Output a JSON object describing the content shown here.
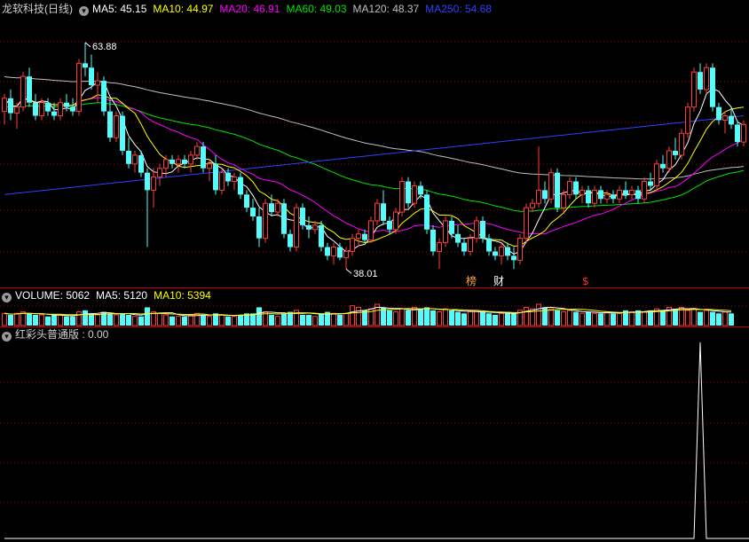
{
  "header": {
    "title": "龙软科技(日线)",
    "ma5": "MA5: 45.15",
    "ma10": "MA10: 44.97",
    "ma20": "MA20: 46.91",
    "ma60": "MA60: 49.03",
    "ma120": "MA120: 48.37",
    "ma250": "MA250: 54.68"
  },
  "volume_header": {
    "label": "VOLUME: 5062",
    "ma5": "MA5: 5120",
    "ma10": "MA10: 5394"
  },
  "indicator_header": {
    "label": "红彩头普通版 : 0.00"
  },
  "annotations": {
    "high": "63.88",
    "low": "38.01",
    "badge_bang": "榜",
    "badge_cai": "财",
    "badge_dollar": "$"
  },
  "colors": {
    "up": "#ff3c3c",
    "down": "#54fcfc",
    "ma5": "#ffffff",
    "ma10": "#ffff00",
    "ma20": "#ff00ff",
    "ma60": "#00e600",
    "ma120": "#c0c0c0",
    "ma250": "#3040ff",
    "grid": "#a00000"
  },
  "chart_data": {
    "type": "candlestick",
    "price_range": [
      36.5,
      66.5
    ],
    "candles": [
      [
        56.0,
        58.0,
        54.5,
        57.5
      ],
      [
        57.5,
        58.5,
        55.0,
        55.8
      ],
      [
        55.8,
        57.0,
        54.0,
        56.5
      ],
      [
        56.5,
        60.5,
        56.0,
        60.0
      ],
      [
        60.0,
        61.0,
        56.5,
        57.0
      ],
      [
        57.0,
        58.0,
        55.0,
        55.5
      ],
      [
        55.5,
        57.5,
        55.0,
        57.0
      ],
      [
        57.0,
        57.5,
        55.5,
        56.0
      ],
      [
        56.0,
        57.0,
        55.0,
        55.5
      ],
      [
        55.5,
        57.5,
        55.0,
        57.0
      ],
      [
        57.0,
        58.0,
        56.0,
        56.5
      ],
      [
        56.5,
        57.5,
        55.5,
        56.0
      ],
      [
        56.0,
        62.0,
        55.5,
        61.5
      ],
      [
        61.5,
        63.88,
        60.0,
        61.0
      ],
      [
        61.0,
        62.5,
        58.5,
        59.0
      ],
      [
        59.0,
        60.5,
        57.0,
        59.5
      ],
      [
        59.5,
        60.0,
        55.5,
        56.0
      ],
      [
        56.0,
        57.5,
        52.5,
        53.0
      ],
      [
        53.0,
        56.0,
        52.5,
        55.5
      ],
      [
        55.5,
        56.0,
        51.0,
        51.5
      ],
      [
        51.5,
        53.0,
        49.5,
        50.0
      ],
      [
        50.0,
        51.5,
        49.0,
        51.0
      ],
      [
        51.0,
        51.5,
        48.5,
        49.0
      ],
      [
        49.0,
        49.5,
        40.5,
        47.0
      ],
      [
        47.0,
        49.5,
        45.0,
        48.5
      ],
      [
        48.5,
        50.0,
        47.5,
        49.5
      ],
      [
        49.5,
        51.0,
        48.5,
        50.5
      ],
      [
        50.5,
        51.0,
        49.5,
        50.0
      ],
      [
        50.0,
        51.0,
        49.0,
        50.5
      ],
      [
        50.5,
        51.0,
        49.5,
        50.0
      ],
      [
        50.0,
        51.5,
        49.0,
        51.0
      ],
      [
        51.0,
        52.5,
        50.5,
        52.0
      ],
      [
        52.0,
        52.5,
        49.0,
        49.5
      ],
      [
        49.5,
        50.5,
        48.0,
        50.0
      ],
      [
        50.0,
        51.0,
        46.5,
        47.0
      ],
      [
        47.0,
        49.5,
        46.5,
        49.0
      ],
      [
        49.0,
        49.5,
        47.5,
        48.0
      ],
      [
        48.0,
        49.0,
        47.0,
        48.5
      ],
      [
        48.5,
        49.0,
        46.0,
        46.5
      ],
      [
        46.5,
        47.0,
        44.5,
        45.0
      ],
      [
        45.0,
        46.0,
        43.5,
        44.0
      ],
      [
        44.0,
        45.0,
        40.5,
        41.5
      ],
      [
        41.5,
        46.0,
        41.0,
        45.5
      ],
      [
        45.5,
        46.5,
        44.0,
        44.5
      ],
      [
        44.5,
        46.0,
        44.0,
        45.5
      ],
      [
        45.5,
        46.0,
        41.5,
        42.0
      ],
      [
        42.0,
        42.5,
        40.0,
        40.5
      ],
      [
        40.5,
        45.5,
        40.0,
        45.0
      ],
      [
        45.0,
        45.5,
        42.5,
        43.0
      ],
      [
        43.0,
        44.0,
        41.5,
        42.5
      ],
      [
        42.5,
        43.5,
        42.0,
        43.0
      ],
      [
        43.0,
        43.5,
        40.0,
        40.5
      ],
      [
        40.5,
        41.0,
        39.0,
        39.5
      ],
      [
        39.5,
        41.0,
        38.5,
        40.5
      ],
      [
        40.5,
        41.0,
        39.0,
        39.3
      ],
      [
        39.3,
        40.5,
        38.0,
        40.0
      ],
      [
        40.0,
        42.0,
        39.5,
        41.5
      ],
      [
        41.5,
        42.5,
        40.5,
        42.0
      ],
      [
        42.0,
        42.5,
        41.0,
        41.3
      ],
      [
        41.3,
        44.0,
        41.0,
        43.5
      ],
      [
        43.5,
        46.0,
        43.0,
        45.5
      ],
      [
        45.5,
        47.0,
        43.0,
        43.5
      ],
      [
        43.5,
        44.0,
        42.0,
        42.5
      ],
      [
        42.5,
        45.0,
        42.0,
        44.5
      ],
      [
        44.5,
        48.5,
        44.0,
        48.0
      ],
      [
        48.0,
        48.5,
        45.0,
        45.5
      ],
      [
        45.5,
        48.0,
        45.0,
        47.5
      ],
      [
        47.5,
        48.0,
        46.0,
        46.5
      ],
      [
        46.5,
        47.0,
        42.0,
        42.5
      ],
      [
        42.5,
        43.0,
        39.5,
        40.0
      ],
      [
        40.0,
        41.5,
        38.01,
        41.0
      ],
      [
        41.0,
        44.0,
        40.5,
        43.5
      ],
      [
        43.5,
        44.0,
        41.5,
        42.0
      ],
      [
        42.0,
        43.0,
        40.5,
        41.0
      ],
      [
        41.0,
        41.5,
        39.5,
        40.0
      ],
      [
        40.0,
        42.0,
        39.5,
        41.5
      ],
      [
        41.5,
        44.0,
        41.0,
        43.5
      ],
      [
        43.5,
        44.0,
        41.0,
        41.5
      ],
      [
        41.5,
        42.0,
        39.5,
        40.0
      ],
      [
        40.0,
        40.5,
        39.0,
        39.5
      ],
      [
        39.5,
        41.0,
        38.5,
        40.5
      ],
      [
        40.5,
        41.0,
        39.0,
        39.5
      ],
      [
        39.5,
        40.5,
        38.0,
        39.0
      ],
      [
        39.0,
        42.0,
        38.5,
        41.5
      ],
      [
        41.5,
        45.5,
        41.0,
        45.0
      ],
      [
        45.0,
        46.0,
        44.5,
        45.5
      ],
      [
        45.5,
        52.0,
        45.0,
        47.0
      ],
      [
        47.0,
        48.0,
        45.5,
        46.0
      ],
      [
        46.0,
        49.5,
        45.5,
        49.0
      ],
      [
        49.0,
        49.5,
        44.5,
        45.0
      ],
      [
        45.0,
        47.0,
        44.5,
        46.5
      ],
      [
        46.5,
        48.5,
        46.0,
        48.0
      ],
      [
        48.0,
        48.5,
        46.0,
        46.5
      ],
      [
        46.5,
        47.5,
        45.5,
        47.0
      ],
      [
        47.0,
        47.5,
        45.0,
        45.5
      ],
      [
        45.5,
        47.5,
        45.0,
        47.0
      ],
      [
        47.0,
        47.5,
        45.5,
        46.0
      ],
      [
        46.0,
        47.0,
        45.5,
        46.5
      ],
      [
        46.5,
        47.0,
        45.5,
        46.0
      ],
      [
        46.0,
        47.5,
        45.5,
        47.0
      ],
      [
        47.0,
        48.0,
        46.0,
        46.5
      ],
      [
        46.5,
        47.5,
        46.0,
        47.0
      ],
      [
        47.0,
        47.5,
        45.5,
        46.0
      ],
      [
        46.0,
        48.5,
        45.5,
        48.0
      ],
      [
        48.0,
        49.0,
        47.0,
        47.5
      ],
      [
        47.5,
        50.5,
        47.0,
        50.0
      ],
      [
        50.0,
        51.0,
        49.0,
        49.5
      ],
      [
        49.5,
        52.0,
        49.0,
        51.5
      ],
      [
        51.5,
        53.0,
        50.5,
        51.0
      ],
      [
        51.0,
        54.0,
        50.5,
        53.5
      ],
      [
        53.5,
        57.0,
        53.0,
        56.5
      ],
      [
        56.5,
        61.0,
        56.0,
        60.5
      ],
      [
        60.5,
        61.5,
        58.0,
        58.5
      ],
      [
        58.5,
        61.5,
        58.0,
        61.0
      ],
      [
        61.0,
        61.5,
        56.0,
        56.5
      ],
      [
        56.5,
        57.0,
        54.5,
        55.0
      ],
      [
        55.0,
        56.0,
        53.5,
        55.5
      ],
      [
        55.5,
        56.5,
        54.0,
        54.5
      ],
      [
        54.5,
        55.0,
        52.0,
        52.5
      ],
      [
        52.5,
        55.0,
        52.0,
        54.5
      ]
    ],
    "volumes": [
      8,
      7,
      8,
      9,
      8,
      7,
      7,
      6,
      7,
      7,
      6,
      6,
      9,
      10,
      8,
      7,
      9,
      8,
      7,
      8,
      7,
      6,
      6,
      12,
      9,
      8,
      7,
      6,
      6,
      6,
      7,
      8,
      7,
      6,
      8,
      7,
      6,
      6,
      7,
      8,
      8,
      12,
      9,
      7,
      6,
      8,
      9,
      10,
      7,
      7,
      6,
      8,
      9,
      8,
      7,
      8,
      13,
      12,
      10,
      11,
      14,
      12,
      10,
      9,
      11,
      10,
      12,
      11,
      12,
      10,
      9,
      11,
      10,
      9,
      8,
      9,
      10,
      9,
      8,
      7,
      8,
      9,
      8,
      10,
      12,
      11,
      14,
      12,
      11,
      10,
      9,
      10,
      9,
      8,
      9,
      8,
      8,
      9,
      8,
      8,
      10,
      9,
      10,
      9,
      10,
      11,
      10,
      12,
      11,
      12,
      10,
      11,
      9,
      10,
      9,
      8,
      9,
      8
    ],
    "indicator": {
      "range": [
        0,
        1
      ],
      "values": [
        0,
        0,
        0,
        0,
        0,
        0,
        0,
        0,
        0,
        0,
        0,
        0,
        0,
        0,
        0,
        0,
        0,
        0,
        0,
        0,
        0,
        0,
        0,
        0,
        0,
        0,
        0,
        0,
        0,
        0,
        0,
        0,
        0,
        0,
        0,
        0,
        0,
        0,
        0,
        0,
        0,
        0,
        0,
        0,
        0,
        0,
        0,
        0,
        0,
        0,
        0,
        0,
        0,
        0,
        0,
        0,
        0,
        0,
        0,
        0,
        0,
        0,
        0,
        0,
        0,
        0,
        0,
        0,
        0,
        0,
        0,
        0,
        0,
        0,
        0,
        0,
        0,
        0,
        0,
        0,
        0,
        0,
        0,
        0,
        0,
        0,
        0,
        0,
        0,
        0,
        0,
        0,
        0,
        0,
        0,
        0,
        0,
        0,
        0,
        0,
        0,
        0,
        0,
        0,
        0,
        0,
        0,
        0,
        0,
        0,
        0,
        0,
        1,
        0,
        0,
        0,
        0,
        0,
        0,
        0,
        0,
        0
      ]
    },
    "ma60_start": 56.5,
    "ma120_start": 60.0,
    "ma250_start": 46.5,
    "ma250_end": 55.5
  }
}
